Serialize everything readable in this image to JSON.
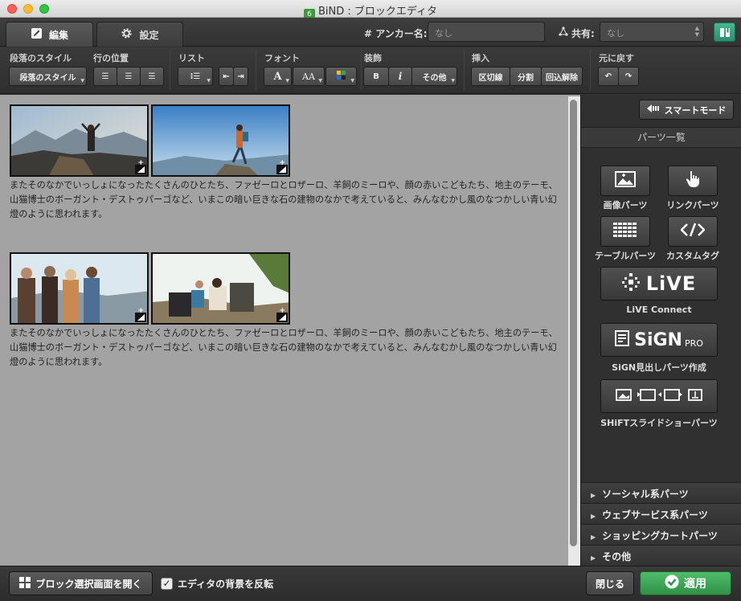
{
  "window": {
    "title": "BiND : ブロックエディタ",
    "app_badge": "6"
  },
  "tabs": [
    {
      "label": "編集"
    },
    {
      "label": "設定"
    }
  ],
  "anchor": {
    "label": "# アンカー名:",
    "value": "なし"
  },
  "share": {
    "label": "共有:",
    "value": "なし"
  },
  "toolbar": {
    "paragraph_style": {
      "label": "段落のスタイル",
      "button": "段落のスタイル"
    },
    "line_position": {
      "label": "行の位置"
    },
    "list": {
      "label": "リスト"
    },
    "font": {
      "label": "フォント",
      "size_button": "A",
      "case_button": "AA"
    },
    "decoration": {
      "label": "装飾",
      "bold": "B",
      "italic": "i",
      "other": "その他"
    },
    "insert": {
      "label": "挿入",
      "divider": "区切線",
      "split": "分割",
      "wrap_clear": "回込解除"
    },
    "undo": {
      "label": "元に戻す"
    }
  },
  "blocks": [
    {
      "text": "またそのなかでいっしょになったたくさんのひとたち、ファゼーロとロザーロ、羊飼のミーロや、顔の赤いこどもたち、地主のテーモ、山猫博士のボーガント・デストゥパーゴなど、いまこの暗い巨きな石の建物のなかで考えていると、みんなむかし風のなつかしい青い幻燈のように思われます。"
    },
    {
      "text": "またそのなかでいっしょになったたくさんのひとたち、ファゼーロとロザーロ、羊飼のミーロや、顔の赤いこどもたち、地主のテーモ、山猫博士のボーガント・デストゥパーゴなど、いまこの暗い巨きな石の建物のなかで考えていると、みんなむかし風のなつかしい青い幻燈のように思われます。"
    }
  ],
  "panel": {
    "smart_mode": "スマートモード",
    "parts_header": "パーツ一覧",
    "parts": [
      "画像パーツ",
      "リンクパーツ",
      "テーブルパーツ",
      "カスタムタグ"
    ],
    "live": {
      "logo": "LiVE",
      "label": "LiVE Connect"
    },
    "sign": {
      "logo": "SiGN",
      "logo_sub": "PRO",
      "label": "SiGN見出しパーツ作成"
    },
    "shift": {
      "label": "SHiFTスライドショーパーツ"
    },
    "accordions": [
      "ソーシャル系パーツ",
      "ウェブサービス系パーツ",
      "ショッピングカートパーツ",
      "その他"
    ]
  },
  "footer": {
    "open_block_select": "ブロック選択画面を開く",
    "invert_bg": "エディタの背景を反転",
    "invert_bg_checked": true,
    "close": "閉じる",
    "apply": "適用"
  },
  "colors": {
    "accent_green": "#3aa356",
    "editor_bg": "#a3a3a3"
  }
}
